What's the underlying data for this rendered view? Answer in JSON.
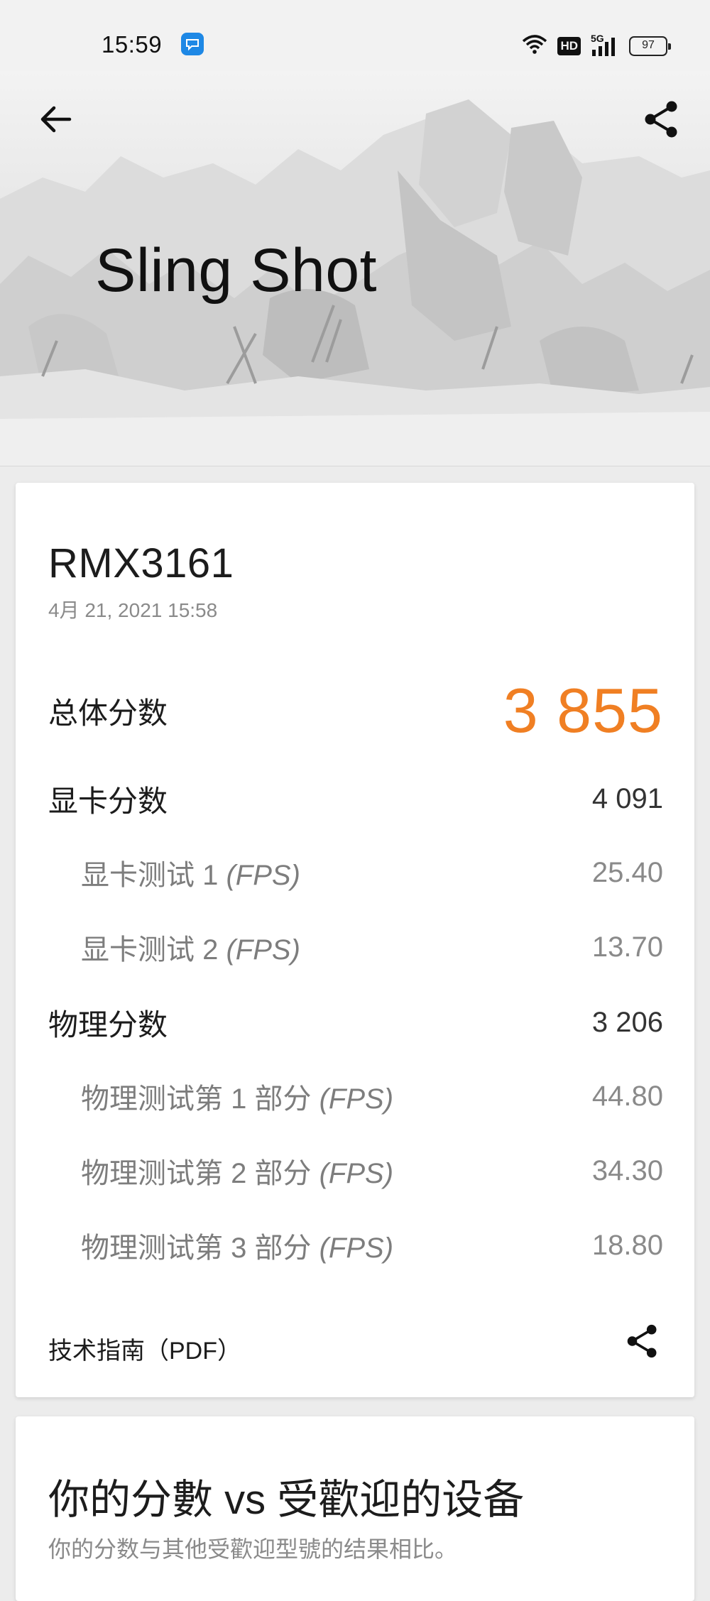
{
  "status_bar": {
    "time": "15:59",
    "hd": "HD",
    "network": "5G",
    "battery": "97"
  },
  "header": {
    "title": "Sling Shot"
  },
  "result": {
    "device": "RMX3161",
    "date": "4月 21, 2021 15:58",
    "overall_label": "总体分数",
    "overall_value": "3 855",
    "graphics_label": "显卡分数",
    "graphics_value": "4 091",
    "graphics_tests": [
      {
        "label": "显卡测试 1 ",
        "unit": "(FPS)",
        "value": "25.40"
      },
      {
        "label": "显卡测试 2 ",
        "unit": "(FPS)",
        "value": "13.70"
      }
    ],
    "physics_label": "物理分数",
    "physics_value": "3 206",
    "physics_tests": [
      {
        "label": "物理测试第 1 部分 ",
        "unit": "(FPS)",
        "value": "44.80"
      },
      {
        "label": "物理测试第 2 部分 ",
        "unit": "(FPS)",
        "value": "34.30"
      },
      {
        "label": "物理测试第 3 部分 ",
        "unit": "(FPS)",
        "value": "18.80"
      }
    ],
    "guide_label": "技术指南（PDF）"
  },
  "comparison": {
    "title": "你的分數 vs 受歡迎的设备",
    "subtitle": "你的分数与其他受歡迎型號的结果相比。"
  },
  "colors": {
    "accent": "#f07f23",
    "background": "#ececec",
    "card": "#ffffff"
  },
  "icons": [
    "back-arrow-icon",
    "share-icon",
    "wifi-icon",
    "signal-icon",
    "battery-icon",
    "app-notification-icon"
  ]
}
